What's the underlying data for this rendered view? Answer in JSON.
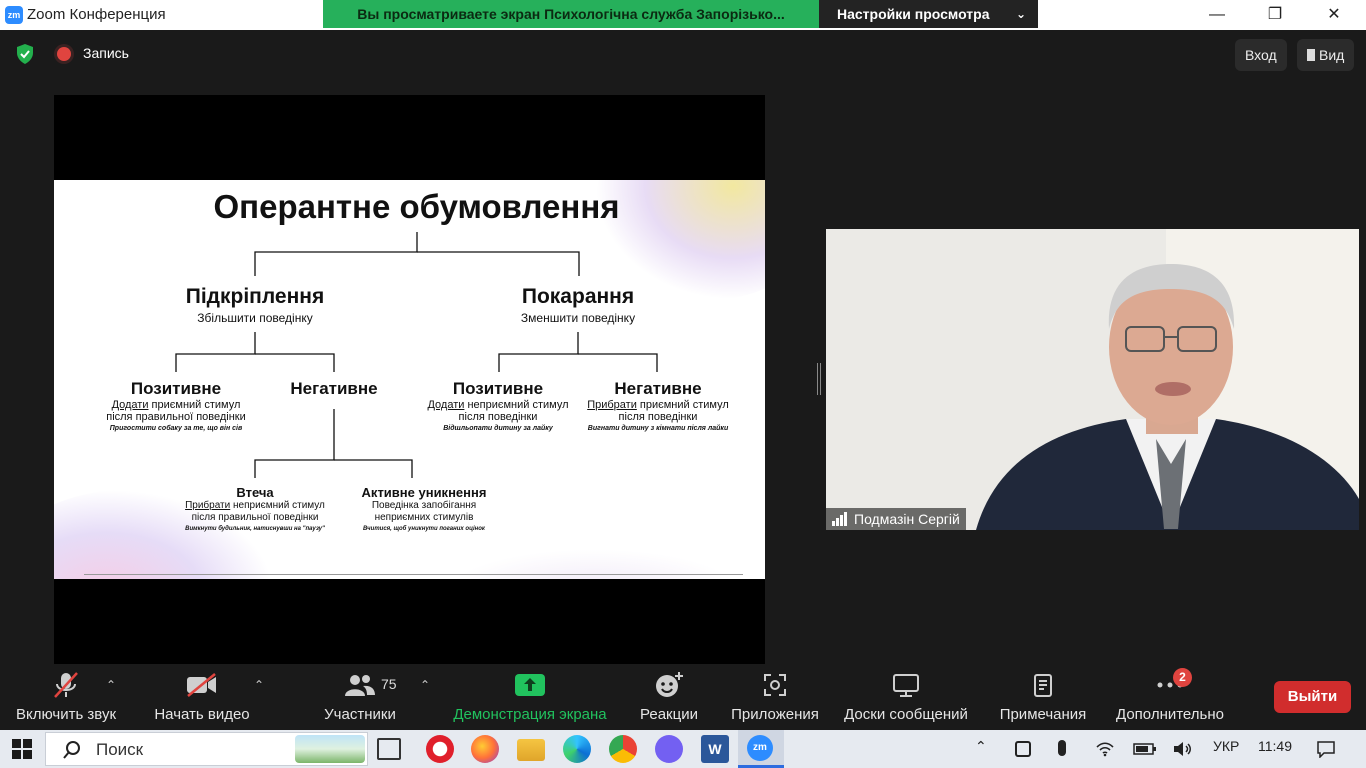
{
  "window": {
    "title": "Zoom Конференция",
    "logo": "zm",
    "viewing_banner": "Вы просматриваете экран  Психологічна служба Запорізько...",
    "view_options": "Настройки просмотра"
  },
  "topbar": {
    "recording_label": "Запись",
    "signin_label": "Вход",
    "view_label": "Вид"
  },
  "slide": {
    "title": "Оперантне обумовлення",
    "reinforcement": {
      "title": "Підкріплення",
      "desc": "Збільшити поведінку"
    },
    "punishment": {
      "title": "Покарання",
      "desc": "Зменшити поведінку"
    },
    "pos_reinf": {
      "title": "Позитивне",
      "verb": "Додати",
      "line1": " приємний стимул",
      "line2": "після правильної поведінки",
      "example": "Пригостити собаку за те, що він сів"
    },
    "neg_reinf": {
      "title": "Негативне"
    },
    "pos_pun": {
      "title": "Позитивне",
      "verb": "Додати",
      "line1": " неприємний стимул",
      "line2": "після поведінки",
      "example": "Відшльопати дитину за лайку"
    },
    "neg_pun": {
      "title": "Негативне",
      "verb": "Прибрати",
      "line1": " приємний стимул",
      "line2": "після поведінки",
      "example": "Вигнати дитину з кімнати після лайки"
    },
    "escape": {
      "title": "Втеча",
      "verb": "Прибрати",
      "line1": " неприємний стимул",
      "line2": "після правильної поведінки",
      "example": "Вимкнути будильник, натиснувши на \"паузу\""
    },
    "avoid": {
      "title": "Активне уникнення",
      "line1": "Поведінка запобігання",
      "line2": "неприємних стимулів",
      "example": "Вчитися, щоб уникнути поганих оцінок"
    }
  },
  "participant_video": {
    "name": "Подмазін Сергій"
  },
  "toolbar": {
    "mute": "Включить звук",
    "video": "Начать видео",
    "participants": "Участники",
    "participants_count": "75",
    "share": "Демонстрация экрана",
    "reactions": "Реакции",
    "apps": "Приложения",
    "whiteboards": "Доски сообщений",
    "notes": "Примечания",
    "more": "Дополнительно",
    "more_badge": "2",
    "leave": "Выйти"
  },
  "taskbar": {
    "search_text": "Поиск",
    "language": "УКР",
    "time": "11:49"
  },
  "colors": {
    "share_green": "#21c25e",
    "leave_red": "#d12d2d",
    "zoom_blue": "#2d8cff"
  }
}
